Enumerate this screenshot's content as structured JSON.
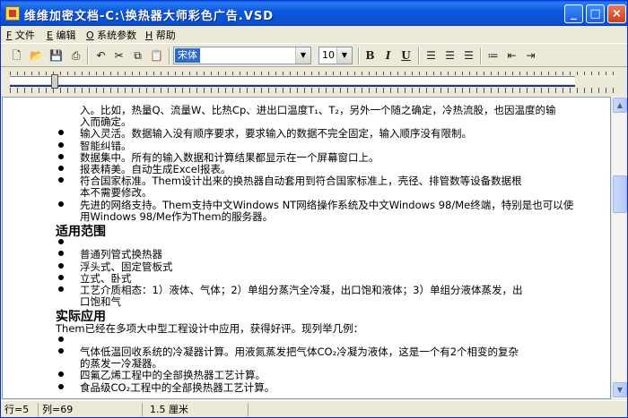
{
  "window": {
    "title": "维维加密文档-C:\\换热器大师彩色广告.VSD",
    "controls": {
      "minimize": "_",
      "maximize": "□",
      "close": "×"
    }
  },
  "menu": [
    {
      "key": "F",
      "label": "文件"
    },
    {
      "key": "E",
      "label": "编辑"
    },
    {
      "key": "O",
      "label": "系统参数"
    },
    {
      "key": "H",
      "label": "帮助"
    }
  ],
  "toolbar": {
    "font": "宋体",
    "size": "10",
    "bold": "B",
    "italic": "I",
    "underline": "U"
  },
  "document": {
    "top_partial": [
      "入。比如，热量Q、流量W、比热Cp、进出口温度T₁、T₂，另外一个随之确定，冷热流股，也因温度的输",
      "入而确定。"
    ],
    "features": [
      [
        "输入灵活。数据输入没有顺序要求，要求输入的数据不完全固定，输入顺序没有限制。"
      ],
      [
        "智能纠错。"
      ],
      [
        "数据集中。所有的输入数据和计算结果都显示在一个屏幕窗口上。"
      ],
      [
        "报表精美。自动生成Excel报表。"
      ],
      [
        "符合国家标准。Them设计出来的换热器自动套用到符合国家标准上，壳径、排管数等设备数据根",
        "本不需要修改。"
      ],
      [
        "先进的网络支持。Them支持中文Windows NT网络操作系统及中文Windows 98/Me终端，特别是也可以使",
        "用Windows 98/Me作为Them的服务器。"
      ]
    ],
    "scope_heading": "适用范围",
    "scope_items": [
      [
        ""
      ],
      [
        "普通列管式换热器"
      ],
      [
        "浮头式、固定管板式"
      ],
      [
        "立式、卧式"
      ],
      [
        "工艺介质相态：1）液体、气体；2）单组分蒸汽全冷凝，出口饱和液体；3）单组分液体蒸发，出",
        "口饱和气"
      ]
    ],
    "practice_heading": "实际应用",
    "practice_intro": "Them已经在多项大中型工程设计中应用，获得好评。现列举几例：",
    "practice_items": [
      [
        ""
      ],
      [
        "气体低温回收系统的冷凝器计算。用液氮蒸发把气体CO₂冷凝为液体，这是一个有2个相变的复杂",
        "的蒸发一冷凝器。"
      ],
      [
        "四氟乙烯工程中的全部换热器工艺计算。"
      ],
      [
        "食品级CO₂工程中的全部换热器工艺计算。"
      ]
    ]
  },
  "status": {
    "line": "行=5",
    "col": "列=69",
    "indent": "1.5 厘米"
  }
}
